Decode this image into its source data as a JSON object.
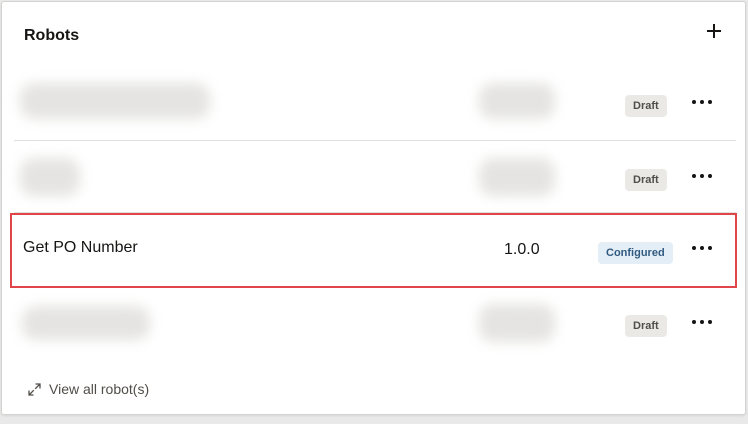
{
  "panel": {
    "title": "Robots",
    "add_icon": "plus-icon"
  },
  "robots": [
    {
      "name": "",
      "version": "",
      "status": "Draft",
      "name_hidden": true
    },
    {
      "name": "",
      "version": "",
      "status": "Draft",
      "name_hidden": true
    },
    {
      "name": "Get PO Number",
      "version": "1.0.0",
      "status": "Configured",
      "name_hidden": false
    },
    {
      "name": "",
      "version": "",
      "status": "Draft",
      "name_hidden": true
    }
  ],
  "footer": {
    "view_all_label": "View all robot(s)",
    "view_all_icon": "expand-icon"
  },
  "colors": {
    "highlight_border": "#e0454a",
    "draft_badge_bg": "#ebe9e6",
    "configured_badge_bg": "#e4eef6",
    "configured_badge_text": "#315a80"
  }
}
